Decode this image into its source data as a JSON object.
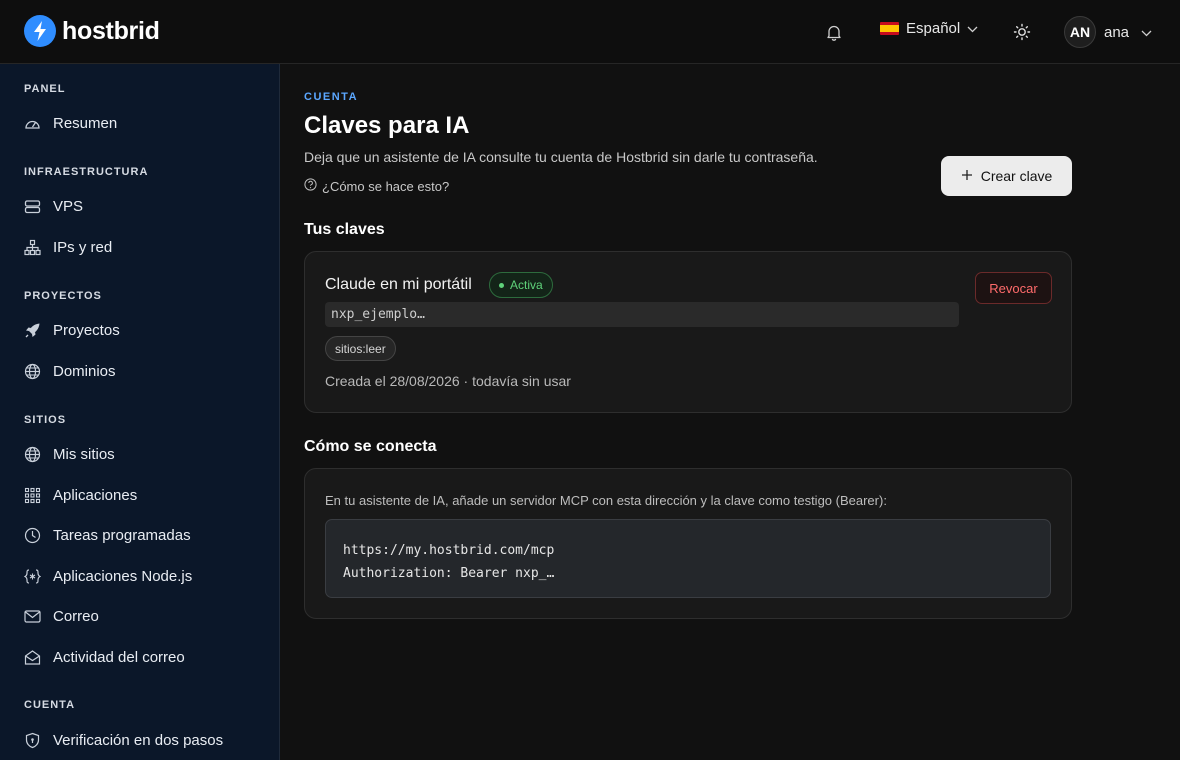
{
  "app": {
    "name": "hostbrid"
  },
  "topbar": {
    "language": "Español",
    "user_initials": "AN",
    "user_name": "ana"
  },
  "sidebar": {
    "sections": [
      {
        "title": "PANEL",
        "items": [
          {
            "label": "Resumen",
            "icon": "gauge-icon"
          }
        ]
      },
      {
        "title": "INFRAESTRUCTURA",
        "items": [
          {
            "label": "VPS",
            "icon": "server-icon"
          },
          {
            "label": "IPs y red",
            "icon": "network-icon"
          }
        ]
      },
      {
        "title": "PROYECTOS",
        "items": [
          {
            "label": "Proyectos",
            "icon": "rocket-icon"
          },
          {
            "label": "Dominios",
            "icon": "globe-icon"
          }
        ]
      },
      {
        "title": "SITIOS",
        "items": [
          {
            "label": "Mis sitios",
            "icon": "globe-icon"
          },
          {
            "label": "Aplicaciones",
            "icon": "grid-icon"
          },
          {
            "label": "Tareas programadas",
            "icon": "clock-icon"
          },
          {
            "label": "Aplicaciones Node.js",
            "icon": "braces-icon"
          },
          {
            "label": "Correo",
            "icon": "mail-icon"
          },
          {
            "label": "Actividad del correo",
            "icon": "mail-activity-icon"
          }
        ]
      },
      {
        "title": "CUENTA",
        "items": [
          {
            "label": "Verificación en dos pasos",
            "icon": "shield-icon"
          }
        ]
      }
    ]
  },
  "main": {
    "eyebrow": "CUENTA",
    "title": "Claves para IA",
    "description": "Deja que un asistente de IA consulte tu cuenta de Hostbrid sin darle tu contraseña.",
    "help_link": "¿Cómo se hace esto?",
    "create_button": "Crear clave",
    "keys_heading": "Tus claves",
    "key": {
      "name": "Claude en mi portátil",
      "status": "Activa",
      "value": "nxp_ejemplo…",
      "scope": "sitios:leer",
      "meta": "Creada el 28/08/2026 · todavía sin usar",
      "revoke_button": "Revocar"
    },
    "connect_heading": "Cómo se conecta",
    "connect_instructions": "En tu asistente de IA, añade un servidor MCP con esta dirección y la clave como testigo (Bearer):",
    "code_line1": "https://my.hostbrid.com/mcp",
    "code_line2": "Authorization: Bearer nxp_…"
  },
  "colors": {
    "accent": "#2f8dff",
    "eyebrow": "#5ba7ff",
    "success": "#5fd27a",
    "danger": "#ff6b6b",
    "sidebar_bg": "#0b1729"
  }
}
